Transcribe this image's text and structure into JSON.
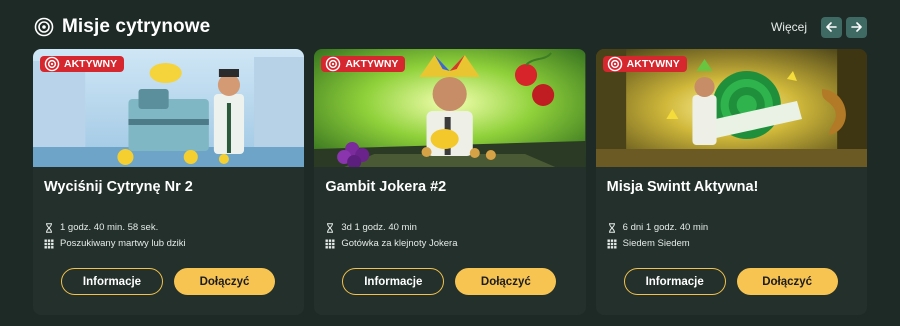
{
  "header": {
    "title": "Misje cytrynowe",
    "title_icon": "target-icon",
    "more_label": "Więcej",
    "prev_icon": "arrow-left-icon",
    "next_icon": "arrow-right-icon"
  },
  "colors": {
    "background": "#1e2a26",
    "card": "#23302c",
    "badge": "#d6262e",
    "accent": "#f7c452",
    "arrow_button": "#3f6a63"
  },
  "cards": [
    {
      "badge": "AKTYWNY",
      "title": "Wyciśnij Cytrynę Nr 2",
      "time": "1 godz. 40 min. 58 sek.",
      "game": "Poszukiwany martwy lub dziki",
      "info_label": "Informacje",
      "join_label": "Dołączyć"
    },
    {
      "badge": "AKTYWNY",
      "title": "Gambit Jokera #2",
      "time": "3d 1 godz. 40 min",
      "game": "Gotówka za klejnoty Jokera",
      "info_label": "Informacje",
      "join_label": "Dołączyć"
    },
    {
      "badge": "AKTYWNY",
      "title": "Misja Swintt Aktywna!",
      "time": "6 dni 1 godz. 40 min",
      "game": "Siedem Siedem",
      "info_label": "Informacje",
      "join_label": "Dołączyć"
    }
  ]
}
